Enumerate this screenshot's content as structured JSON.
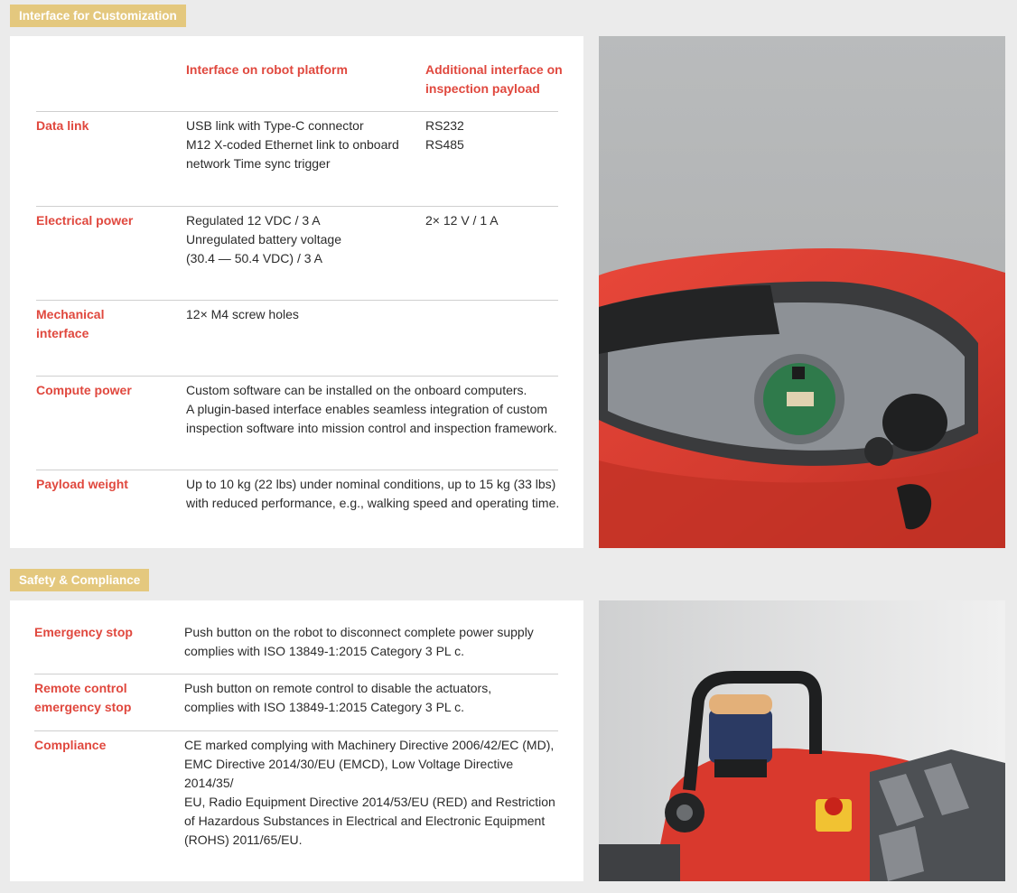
{
  "customization": {
    "tag": "Interface for Customization",
    "header": {
      "col1": "Interface on robot platform",
      "col2": "Additional interface on inspection payload"
    },
    "rows": [
      {
        "label": "Data link",
        "platform": "USB link with Type-C connector\nM12 X-coded Ethernet link to onboard\nnetwork Time sync trigger",
        "payload": "RS232\nRS485"
      },
      {
        "label": "Electrical power",
        "platform": "Regulated 12 VDC / 3 A\nUnregulated battery voltage\n(30.4 — 50.4 VDC) / 3 A",
        "payload": "2× 12 V / 1 A"
      },
      {
        "label": "Mechanical interface",
        "platform": "12× M4 screw holes",
        "payload": ""
      },
      {
        "label": "Compute power",
        "platform": "Custom software can be installed on the onboard computers.\nA plugin-based interface enables seamless integration of custom\ninspection software into mission control and inspection framework.",
        "payload": ""
      },
      {
        "label": "Payload weight",
        "platform": "Up to 10 kg (22 lbs) under nominal conditions, up to 15 kg (33 lbs)\nwith reduced performance, e.g., walking speed and operating time.",
        "payload": ""
      }
    ]
  },
  "safety": {
    "tag": "Safety & Compliance",
    "rows": [
      {
        "label": "Emergency stop",
        "text": "Push button on the robot to disconnect complete power supply\ncomplies with ISO 13849-1:2015 Category 3 PL c."
      },
      {
        "label": "Remote control emergency stop",
        "text": "Push button on remote control to disable the actuators,\ncomplies with ISO 13849-1:2015 Category 3 PL c."
      },
      {
        "label": "Compliance",
        "text": "CE marked complying with Machinery Directive 2006/42/EC (MD),\nEMC Directive 2014/30/EU (EMCD), Low Voltage Directive 2014/35/\nEU, Radio Equipment Directive 2014/53/EU (RED) and Restriction\nof Hazardous Substances in Electrical and Electronic Equipment\n(ROHS) 2011/65/EU."
      }
    ]
  },
  "colors": {
    "accent": "#e0483e",
    "tag_bg": "#e4c87e",
    "page_bg": "#ebebeb"
  }
}
